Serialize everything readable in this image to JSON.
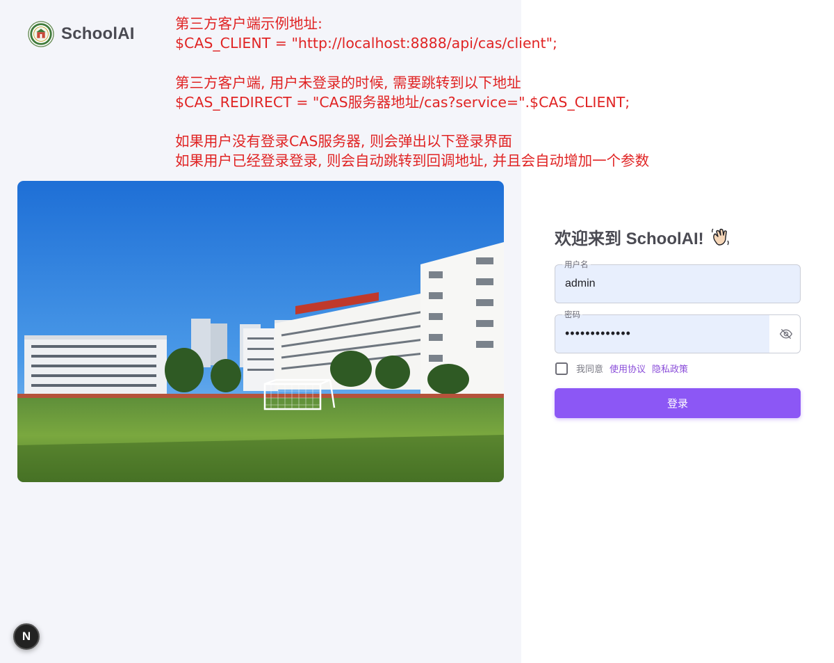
{
  "brand": {
    "name": "SchoolAI",
    "logo_icon": "school-emblem-icon"
  },
  "notes": {
    "lines": [
      "第三方客户端示例地址:",
      "$CAS_CLIENT = \"http://localhost:8888/api/cas/client\";",
      "",
      "第三方客户端, 用户未登录的时候, 需要跳转到以下地址",
      "$CAS_REDIRECT = \"CAS服务器地址/cas?service=\".$CAS_CLIENT;",
      "",
      "如果用户没有登录CAS服务器, 则会弹出以下登录界面",
      "如果用户已经登录登录, 则会自动跳转到回调地址, 并且会自动增加一个参数"
    ],
    "color": "#e02424"
  },
  "hero": {
    "image": "campus-photo"
  },
  "login": {
    "welcome": "欢迎来到 SchoolAI!",
    "welcome_icon": "waving-hand-icon",
    "username": {
      "label": "用户名",
      "value": "admin"
    },
    "password": {
      "label": "密码",
      "value": "•••••••••••••",
      "toggle_icon": "eye-off-icon"
    },
    "agreement": {
      "prefix": "我同意",
      "terms": "使用协议",
      "privacy": "隐私政策",
      "checked": false
    },
    "submit": "登录",
    "accent": "#8c57f5"
  },
  "dev_badge": {
    "label": "N"
  }
}
